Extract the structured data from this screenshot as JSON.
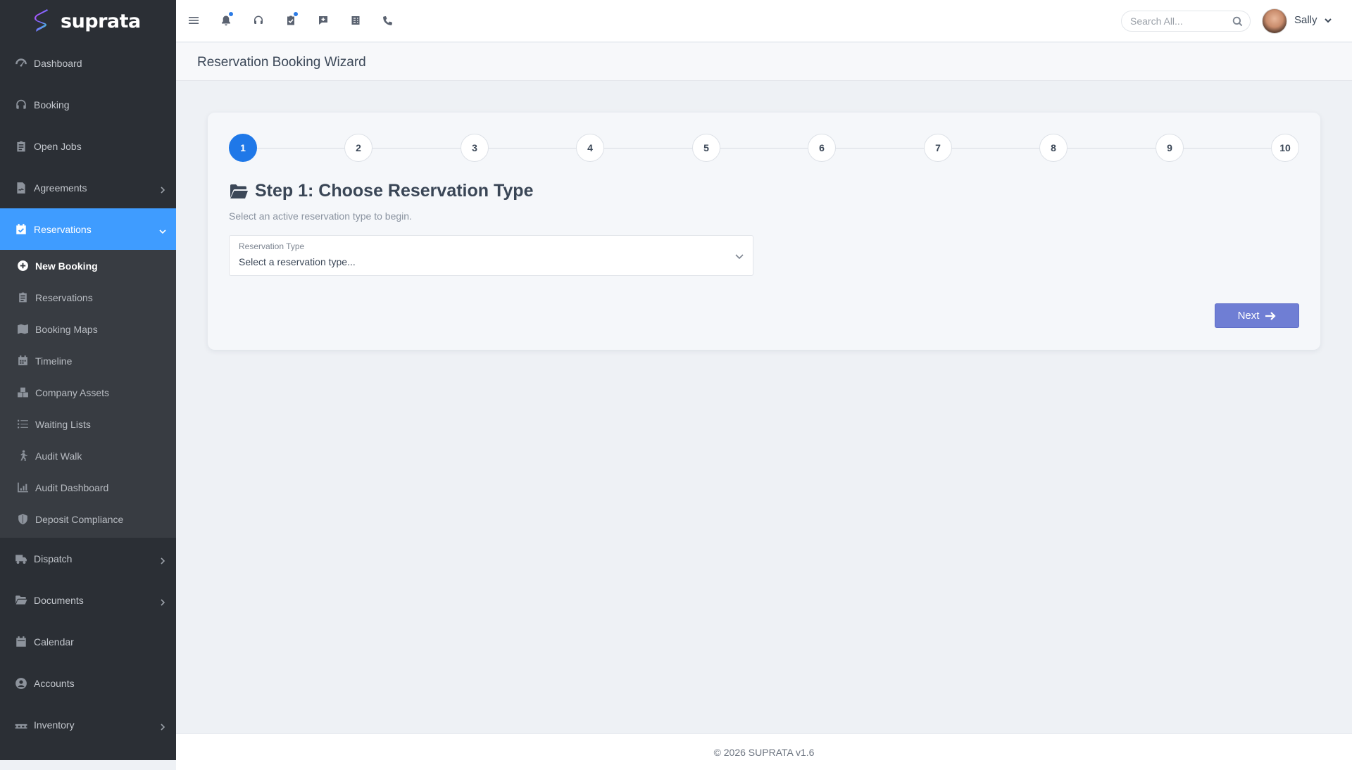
{
  "brand": {
    "name": "suprata"
  },
  "sidebar": {
    "items_top": [
      {
        "label": "Dashboard",
        "icon": "gauge-icon",
        "has_chevron": false
      },
      {
        "label": "Booking",
        "icon": "headset-icon",
        "has_chevron": false
      },
      {
        "label": "Open Jobs",
        "icon": "clipboard-list-icon",
        "has_chevron": false
      },
      {
        "label": "Agreements",
        "icon": "file-signature-icon",
        "has_chevron": true
      }
    ],
    "active_section": {
      "label": "Reservations",
      "icon": "calendar-check-icon",
      "expanded": true
    },
    "sub_items": [
      {
        "label": "New Booking",
        "icon": "plus-circle-icon",
        "current": true
      },
      {
        "label": "Reservations",
        "icon": "clipboard-list-icon",
        "current": false
      },
      {
        "label": "Booking Maps",
        "icon": "map-icon",
        "current": false
      },
      {
        "label": "Timeline",
        "icon": "calendar-days-icon",
        "current": false
      },
      {
        "label": "Company Assets",
        "icon": "boxes-icon",
        "current": false
      },
      {
        "label": "Waiting Lists",
        "icon": "list-icon",
        "current": false
      },
      {
        "label": "Audit Walk",
        "icon": "person-walking-icon",
        "current": false
      },
      {
        "label": "Audit Dashboard",
        "icon": "chart-bars-icon",
        "current": false
      },
      {
        "label": "Deposit Compliance",
        "icon": "shield-icon",
        "current": false
      }
    ],
    "items_bottom": [
      {
        "label": "Dispatch",
        "icon": "truck-icon",
        "has_chevron": true
      },
      {
        "label": "Documents",
        "icon": "folder-open-icon",
        "has_chevron": true
      },
      {
        "label": "Calendar",
        "icon": "calendar-icon",
        "has_chevron": false
      },
      {
        "label": "Accounts",
        "icon": "user-circle-icon",
        "has_chevron": false
      },
      {
        "label": "Inventory",
        "icon": "pallet-icon",
        "has_chevron": true
      }
    ]
  },
  "topbar": {
    "icons": [
      "menu-icon",
      "bell-icon",
      "headset-icon",
      "clipboard-check-icon",
      "comment-plus-icon",
      "receipt-icon",
      "phone-icon"
    ],
    "search_placeholder": "Search All...",
    "user_name": "Sally"
  },
  "page": {
    "title": "Reservation Booking Wizard"
  },
  "wizard": {
    "steps": [
      "1",
      "2",
      "3",
      "4",
      "5",
      "6",
      "7",
      "8",
      "9",
      "10"
    ],
    "active_step": 1,
    "step_title": "Step 1: Choose Reservation Type",
    "step_subtitle": "Select an active reservation type to begin.",
    "field_label": "Reservation Type",
    "field_value": "Select a reservation type...",
    "next_label": "Next"
  },
  "footer": {
    "text": "© 2026 SUPRATA v1.6"
  },
  "colors": {
    "accent": "#3f9cff",
    "sidebar_bg": "#2b2f35",
    "step_active": "#1f78e8",
    "next_button": "#6f7ed4"
  }
}
